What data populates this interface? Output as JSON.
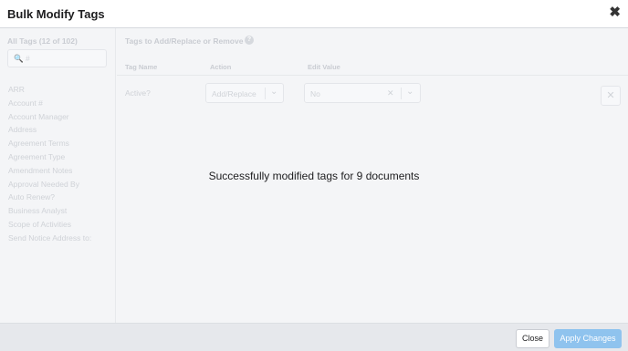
{
  "modal": {
    "title": "Bulk Modify Tags",
    "close_symbol": "✖"
  },
  "left_panel": {
    "title": "All Tags (12 of 102)",
    "search_placeholder": "🔍 #",
    "tags": [
      "ARR",
      "Account #",
      "Account Manager",
      "Address",
      "Agreement Terms",
      "Agreement Type",
      "Amendment Notes",
      "Approval Needed By",
      "Auto Renew?",
      "Business Analyst",
      "Scope of Activities",
      "Send Notice Address to:"
    ]
  },
  "right_panel": {
    "title": "Tags to Add/Replace or Remove",
    "help_symbol": "?",
    "columns": {
      "tag_name": "Tag Name",
      "action": "Action",
      "edit_value": "Edit Value"
    },
    "row": {
      "tag_name": "Active?",
      "action_value": "Add/Replace",
      "edit_value": "No"
    }
  },
  "status": {
    "message": "Successfully modified tags for 9 documents"
  },
  "footer": {
    "close_label": "Close",
    "apply_label": "Apply Changes"
  },
  "colors": {
    "apply_button": "#8fc3ee",
    "body_background": "#f4f5f7"
  }
}
